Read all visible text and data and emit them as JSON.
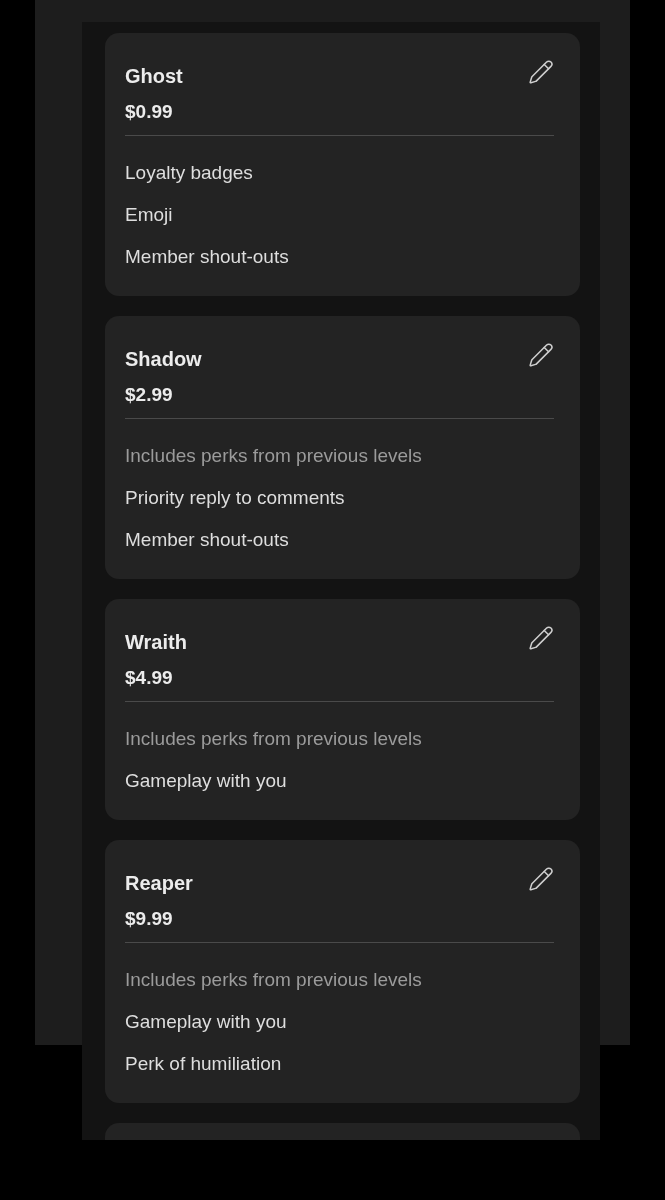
{
  "tiers": [
    {
      "name": "Ghost",
      "price": "$0.99",
      "perks": [
        {
          "kind": "perk",
          "text": "Loyalty badges"
        },
        {
          "kind": "perk",
          "text": "Emoji"
        },
        {
          "kind": "perk",
          "text": "Member shout-outs"
        }
      ]
    },
    {
      "name": "Shadow",
      "price": "$2.99",
      "perks": [
        {
          "kind": "inherited",
          "text": "Includes perks from previous levels"
        },
        {
          "kind": "perk",
          "text": "Priority reply to comments"
        },
        {
          "kind": "perk",
          "text": "Member shout-outs"
        }
      ]
    },
    {
      "name": "Wraith",
      "price": "$4.99",
      "perks": [
        {
          "kind": "inherited",
          "text": "Includes perks from previous levels"
        },
        {
          "kind": "perk",
          "text": "Gameplay with you"
        }
      ]
    },
    {
      "name": "Reaper",
      "price": "$9.99",
      "perks": [
        {
          "kind": "inherited",
          "text": "Includes perks from previous levels"
        },
        {
          "kind": "perk",
          "text": "Gameplay with you"
        },
        {
          "kind": "perk",
          "text": "Perk of humiliation"
        }
      ]
    }
  ]
}
